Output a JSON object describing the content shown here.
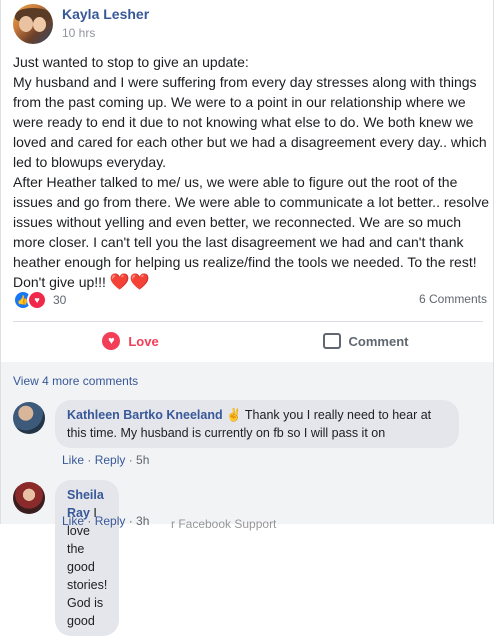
{
  "post": {
    "author": "Kayla Lesher",
    "time": "10 hrs",
    "lines": [
      "Just wanted to stop to give an update:",
      "My husband and I were suffering from every day stresses along with things",
      "from the past coming up. We were to a point in our relationship where we",
      "were ready to end it due to not knowing what else to do. We both knew we",
      "loved and cared for each other but we had a disagreement every day.. which",
      "led to blowups everyday.",
      "After Heather talked to me/ us, we were able to figure out the root of the",
      "issues and go from there. We were able to communicate a lot better.. resolve",
      "issues without yelling and even better, we reconnected. We are so much",
      "more closer. I can't tell you the last disagreement we had and can't thank",
      "heather enough for helping us realize/find the tools we needed. To the rest!",
      "Don't give up!!!"
    ],
    "last_line_emoji": "❤️❤️"
  },
  "reactions": {
    "count": "30",
    "comments": "6 Comments",
    "like_icon": "👍",
    "love_icon": "♥"
  },
  "actions": {
    "love": "Love",
    "comment": "Comment"
  },
  "comments": {
    "view_more": "View 4 more comments",
    "items": [
      {
        "name": "Kathleen Bartko Kneeland",
        "badge": "✌",
        "line1": "Thank you I really need to hear at",
        "line2": "this time. My husband is currently on fb so I will pass it on",
        "like": "Like",
        "reply": "Reply",
        "time": "5h"
      },
      {
        "name": "Sheila Ray",
        "text": "I love the good stories! God is good",
        "like": "Like",
        "reply": "Reply",
        "time": "3h"
      }
    ],
    "ghost_text": "r Facebook Support"
  },
  "colors": {
    "link": "#385898",
    "love": "#f33e58",
    "like_blue": "#1877f2"
  }
}
